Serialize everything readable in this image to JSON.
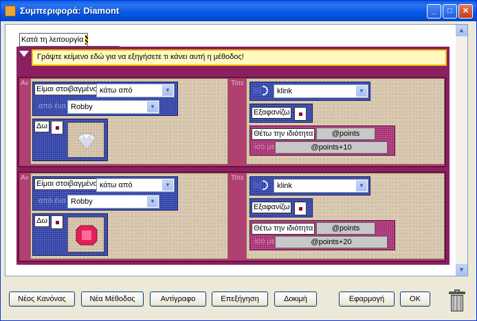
{
  "window": {
    "title": "Συμπεριφορά: Diamont"
  },
  "mode_tab": {
    "label": "Κατά τη λειτουργία"
  },
  "method": {
    "comment": "Γράψτε κείμενο εδώ για να εξηγήσετε τι κάνει αυτή η μέθοδος!"
  },
  "rules": [
    {
      "if_label": "Αν",
      "then_label": "Τότε",
      "condition": {
        "verb": "Είμαι στοιβαγμένο",
        "position": "κάτω από",
        "from_label": "από ένα",
        "object": "Robby"
      },
      "see": {
        "label": "Δω",
        "icon": "diamond-icon"
      },
      "sound": {
        "value": "klink"
      },
      "hide": {
        "label": "Εξαφανίζω"
      },
      "set_property": {
        "label": "Θέτω την ιδιότητα",
        "property": "@points",
        "equals_label": "ίσο με",
        "value": "@points+10"
      }
    },
    {
      "if_label": "Αν",
      "then_label": "Τότε",
      "condition": {
        "verb": "Είμαι στοιβαγμένο",
        "position": "κάτω από",
        "from_label": "από ένα",
        "object": "Robby"
      },
      "see": {
        "label": "Δω",
        "icon": "ruby-icon"
      },
      "sound": {
        "value": "klink"
      },
      "hide": {
        "label": "Εξαφανίζω"
      },
      "set_property": {
        "label": "Θέτω την ιδιότητα",
        "property": "@points",
        "equals_label": "ίσο με",
        "value": "@points+20"
      }
    }
  ],
  "buttons": {
    "new_rule": "Νέος Κανόνας",
    "new_method": "Νέα Μέθοδος",
    "copy": "Αντίγραφο",
    "explain": "Επεξήγηση",
    "test": "Δοκιμή",
    "apply": "Εφαρμογή",
    "ok": "OK"
  },
  "colors": {
    "titlebar": "#0556e6",
    "method_frame": "#8b2060",
    "comment_bg": "#fff9c0"
  }
}
